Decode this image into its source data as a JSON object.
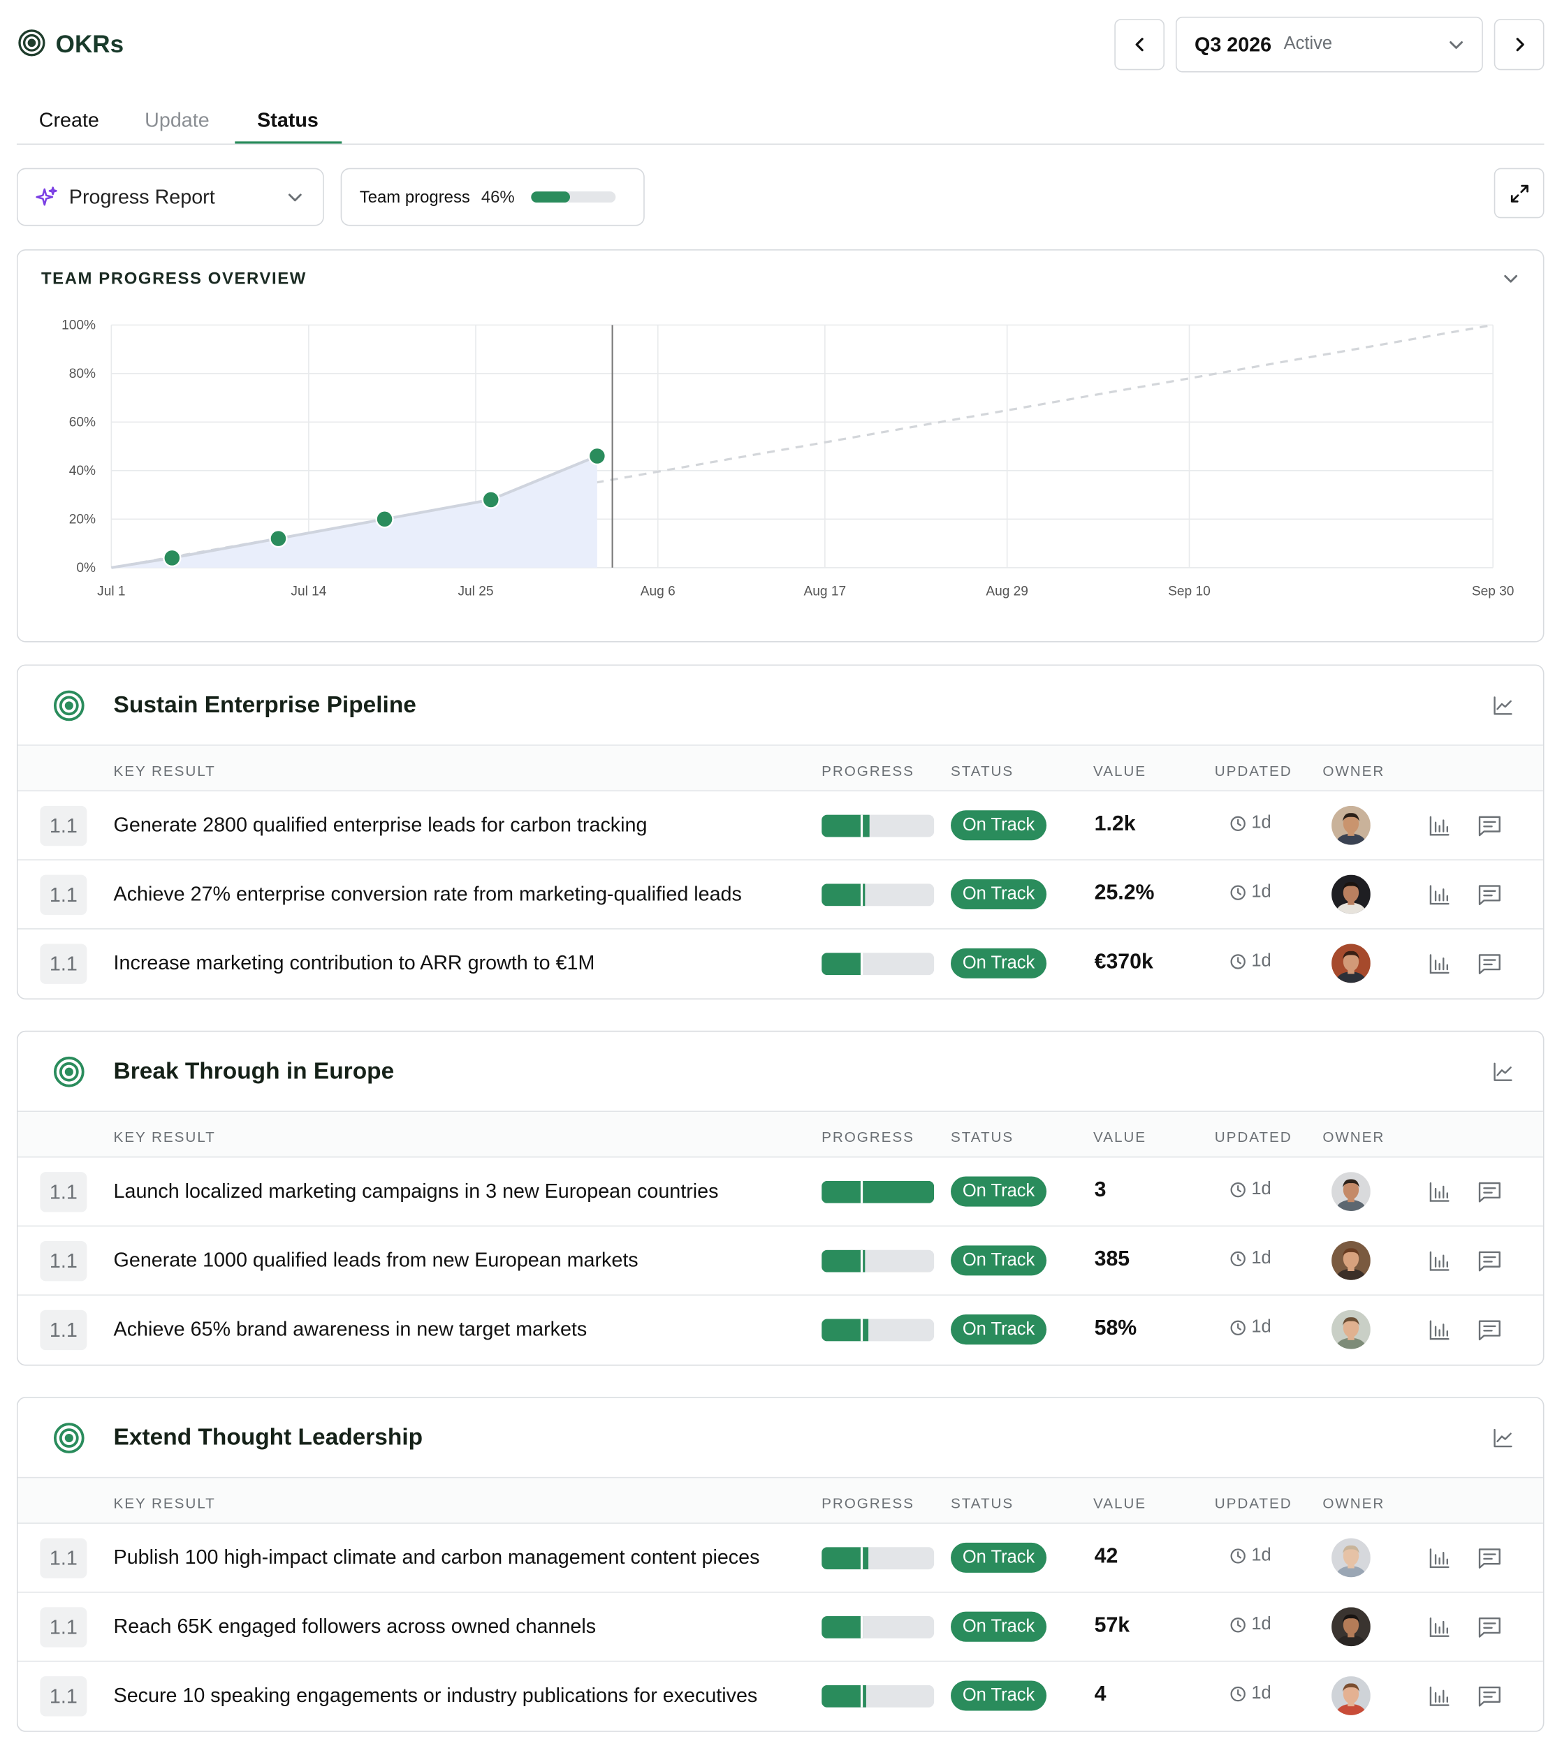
{
  "app": {
    "title": "OKRs"
  },
  "quarter": {
    "label": "Q3 2026",
    "state": "Active"
  },
  "tabs": [
    {
      "label": "Create"
    },
    {
      "label": "Update"
    },
    {
      "label": "Status"
    }
  ],
  "controls": {
    "report_label": "Progress Report",
    "team_progress_label": "Team progress",
    "team_progress_value": "46%",
    "team_progress_fraction": 0.46
  },
  "overview": {
    "title": "TEAM PROGRESS OVERVIEW"
  },
  "chart_data": {
    "type": "line",
    "y_ticks": [
      "100%",
      "80%",
      "60%",
      "40%",
      "20%",
      "0%"
    ],
    "x_ticks": [
      "Jul 1",
      "Jul 14",
      "Jul 25",
      "Aug 6",
      "Aug 17",
      "Aug 29",
      "Sep 10",
      "Sep 30"
    ],
    "ylim": [
      0,
      100
    ],
    "xlim": [
      "2026-07-01",
      "2026-09-30"
    ],
    "today": "2026-08-03",
    "series": [
      {
        "values": [
          {
            "x": "2026-07-05",
            "y": 4
          },
          {
            "x": "2026-07-12",
            "y": 12
          },
          {
            "x": "2026-07-19",
            "y": 20
          },
          {
            "x": "2026-07-26",
            "y": 28
          },
          {
            "x": "2026-08-02",
            "y": 46
          }
        ]
      }
    ],
    "target_line": [
      {
        "x": "2026-07-01",
        "y": 0
      },
      {
        "x": "2026-09-30",
        "y": 100
      }
    ],
    "grid": true
  },
  "table_headers": {
    "key_result": "KEY RESULT",
    "progress": "PROGRESS",
    "status": "STATUS",
    "value": "VALUE",
    "updated": "UPDATED",
    "owner": "OWNER"
  },
  "colors": {
    "accent": "#2a8c5c",
    "area": "#e9eefb"
  },
  "objectives": [
    {
      "title": "Sustain Enterprise Pipeline",
      "krs": [
        {
          "num": "1.1",
          "title": "Generate 2800 qualified enterprise leads for carbon tracking",
          "progress": 0.43,
          "status": "On Track",
          "value": "1.2k",
          "updated": "1d"
        },
        {
          "num": "1.1",
          "title": "Achieve 27% enterprise conversion rate from marketing-qualified leads",
          "progress": 0.39,
          "status": "On Track",
          "value": "25.2%",
          "updated": "1d"
        },
        {
          "num": "1.1",
          "title": "Increase marketing contribution to ARR growth to €1M",
          "progress": 0.36,
          "status": "On Track",
          "value": "€370k",
          "updated": "1d"
        }
      ]
    },
    {
      "title": "Break Through in Europe",
      "krs": [
        {
          "num": "1.1",
          "title": "Launch localized marketing campaigns in 3 new European countries",
          "progress": 1.0,
          "status": "On Track",
          "value": "3",
          "updated": "1d"
        },
        {
          "num": "1.1",
          "title": "Generate 1000 qualified leads from new European markets",
          "progress": 0.385,
          "status": "On Track",
          "value": "385",
          "updated": "1d"
        },
        {
          "num": "1.1",
          "title": "Achieve 65% brand awareness in new target markets",
          "progress": 0.42,
          "status": "On Track",
          "value": "58%",
          "updated": "1d"
        }
      ]
    },
    {
      "title": "Extend Thought Leadership",
      "krs": [
        {
          "num": "1.1",
          "title": "Publish 100 high-impact climate and carbon management content pieces",
          "progress": 0.42,
          "status": "On Track",
          "value": "42",
          "updated": "1d"
        },
        {
          "num": "1.1",
          "title": "Reach 65K engaged followers across owned channels",
          "progress": 0.37,
          "status": "On Track",
          "value": "57k",
          "updated": "1d"
        },
        {
          "num": "1.1",
          "title": "Secure 10 speaking engagements or industry publications for executives",
          "progress": 0.4,
          "status": "On Track",
          "value": "4",
          "updated": "1d"
        }
      ]
    }
  ],
  "avatars": [
    {
      "bg": "#c9b29a",
      "hair": "#2b2018",
      "skin": "#c9946e",
      "shirt": "#3a4252"
    },
    {
      "bg": "#1e1e22",
      "hair": "#1a1410",
      "skin": "#b98060",
      "shirt": "#e7e3dc"
    },
    {
      "bg": "#a64a2c",
      "hair": "#3a1f14",
      "skin": "#d29a78",
      "shirt": "#2c3038"
    },
    {
      "bg": "#d9dadc",
      "hair": "#2d221a",
      "skin": "#c48a68",
      "shirt": "#5d6770"
    },
    {
      "bg": "#7a5a40",
      "hair": "#6a3d22",
      "skin": "#d8a27e",
      "shirt": "#3b2f28"
    },
    {
      "bg": "#c9cfc6",
      "hair": "#6c5036",
      "skin": "#e0b190",
      "shirt": "#7d8b78"
    },
    {
      "bg": "#d6d8dc",
      "hair": "#c8b49a",
      "skin": "#e6c2a6",
      "shirt": "#9aa6b4"
    },
    {
      "bg": "#3a3430",
      "hair": "#181412",
      "skin": "#b47c58",
      "shirt": "#2a2624"
    },
    {
      "bg": "#cfd3d8",
      "hair": "#7a4e30",
      "skin": "#e4b192",
      "shirt": "#c84c38"
    }
  ]
}
